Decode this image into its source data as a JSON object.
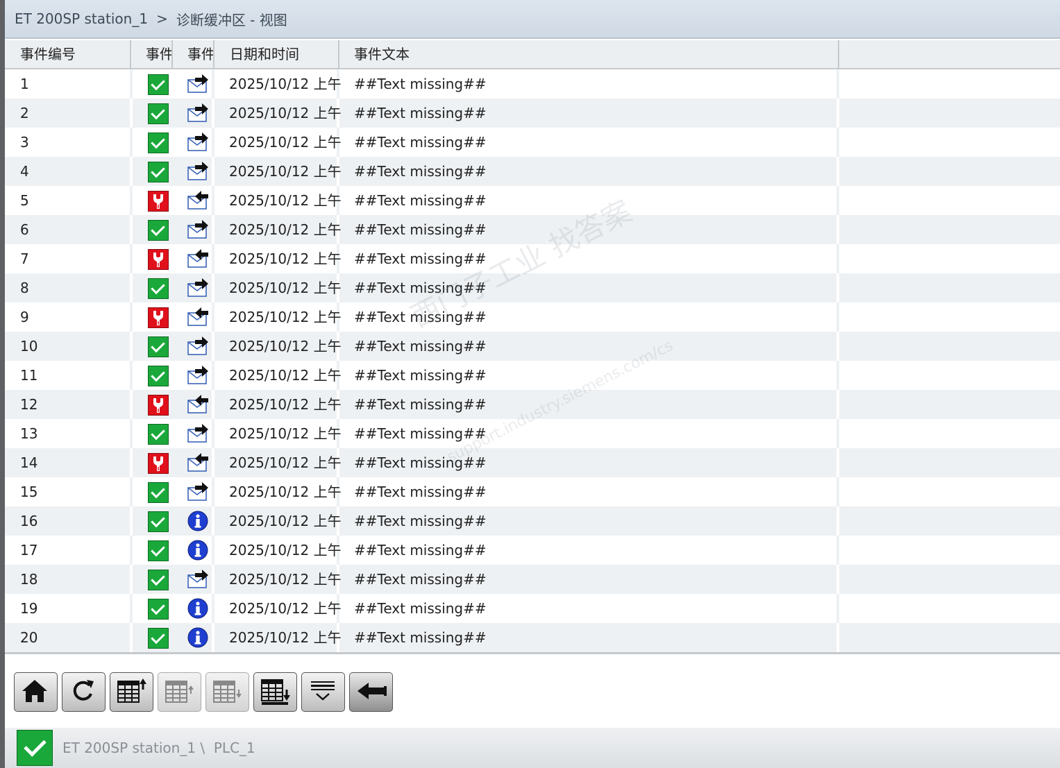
{
  "title": {
    "station": "ET 200SP station_1",
    "separator": ">",
    "view": "诊断缓冲区 - 视图"
  },
  "columns": [
    "事件编号",
    "事件",
    "事件",
    "日期和时间",
    "事件文本"
  ],
  "rows": [
    {
      "no": "1",
      "status": "ok",
      "event": "outgoing",
      "date": "2025/10/12 上午",
      "text": "##Text missing##"
    },
    {
      "no": "2",
      "status": "ok",
      "event": "outgoing",
      "date": "2025/10/12 上午",
      "text": "##Text missing##"
    },
    {
      "no": "3",
      "status": "ok",
      "event": "outgoing",
      "date": "2025/10/12 上午",
      "text": "##Text missing##"
    },
    {
      "no": "4",
      "status": "ok",
      "event": "outgoing",
      "date": "2025/10/12 上午",
      "text": "##Text missing##"
    },
    {
      "no": "5",
      "status": "error",
      "event": "incoming",
      "date": "2025/10/12 上午",
      "text": "##Text missing##"
    },
    {
      "no": "6",
      "status": "ok",
      "event": "outgoing",
      "date": "2025/10/12 上午",
      "text": "##Text missing##"
    },
    {
      "no": "7",
      "status": "error",
      "event": "incoming",
      "date": "2025/10/12 上午",
      "text": "##Text missing##"
    },
    {
      "no": "8",
      "status": "ok",
      "event": "outgoing",
      "date": "2025/10/12 上午",
      "text": "##Text missing##"
    },
    {
      "no": "9",
      "status": "error",
      "event": "incoming",
      "date": "2025/10/12 上午",
      "text": "##Text missing##"
    },
    {
      "no": "10",
      "status": "ok",
      "event": "outgoing",
      "date": "2025/10/12 上午",
      "text": "##Text missing##"
    },
    {
      "no": "11",
      "status": "ok",
      "event": "outgoing",
      "date": "2025/10/12 上午",
      "text": "##Text missing##"
    },
    {
      "no": "12",
      "status": "error",
      "event": "incoming",
      "date": "2025/10/12 上午",
      "text": "##Text missing##"
    },
    {
      "no": "13",
      "status": "ok",
      "event": "outgoing",
      "date": "2025/10/12 上午",
      "text": "##Text missing##"
    },
    {
      "no": "14",
      "status": "error",
      "event": "incoming",
      "date": "2025/10/12 上午",
      "text": "##Text missing##"
    },
    {
      "no": "15",
      "status": "ok",
      "event": "outgoing",
      "date": "2025/10/12 上午",
      "text": "##Text missing##"
    },
    {
      "no": "16",
      "status": "ok",
      "event": "info",
      "date": "2025/10/12 上午",
      "text": "##Text missing##"
    },
    {
      "no": "17",
      "status": "ok",
      "event": "info",
      "date": "2025/10/12 上午",
      "text": "##Text missing##"
    },
    {
      "no": "18",
      "status": "ok",
      "event": "outgoing",
      "date": "2025/10/12 上午",
      "text": "##Text missing##"
    },
    {
      "no": "19",
      "status": "ok",
      "event": "info",
      "date": "2025/10/12 上午",
      "text": "##Text missing##"
    },
    {
      "no": "20",
      "status": "ok",
      "event": "info",
      "date": "2025/10/12 上午",
      "text": "##Text missing##"
    }
  ],
  "toolbar": [
    {
      "name": "home-button",
      "icon": "home-icon",
      "enabled": true
    },
    {
      "name": "refresh-button",
      "icon": "refresh-icon",
      "enabled": true
    },
    {
      "name": "page-up-button",
      "icon": "table-page-up-icon",
      "enabled": true
    },
    {
      "name": "line-up-button",
      "icon": "table-line-up-icon",
      "enabled": false
    },
    {
      "name": "line-down-button",
      "icon": "table-line-down-icon",
      "enabled": false
    },
    {
      "name": "page-down-button",
      "icon": "table-page-down-icon",
      "enabled": true
    },
    {
      "name": "details-button",
      "icon": "expand-details-icon",
      "enabled": true
    },
    {
      "name": "back-button",
      "icon": "back-arrow-icon",
      "enabled": true
    }
  ],
  "status_bar": {
    "status_icon": "ok-check-icon",
    "path": "ET 200SP station_1 \\  PLC_1"
  },
  "watermark": {
    "line1": "西门子工业   找答案",
    "line2": "support.industry.siemens.com/cs"
  },
  "colors": {
    "ok": "#1aa83a",
    "error": "#e0111b",
    "info": "#1f3fd0"
  }
}
